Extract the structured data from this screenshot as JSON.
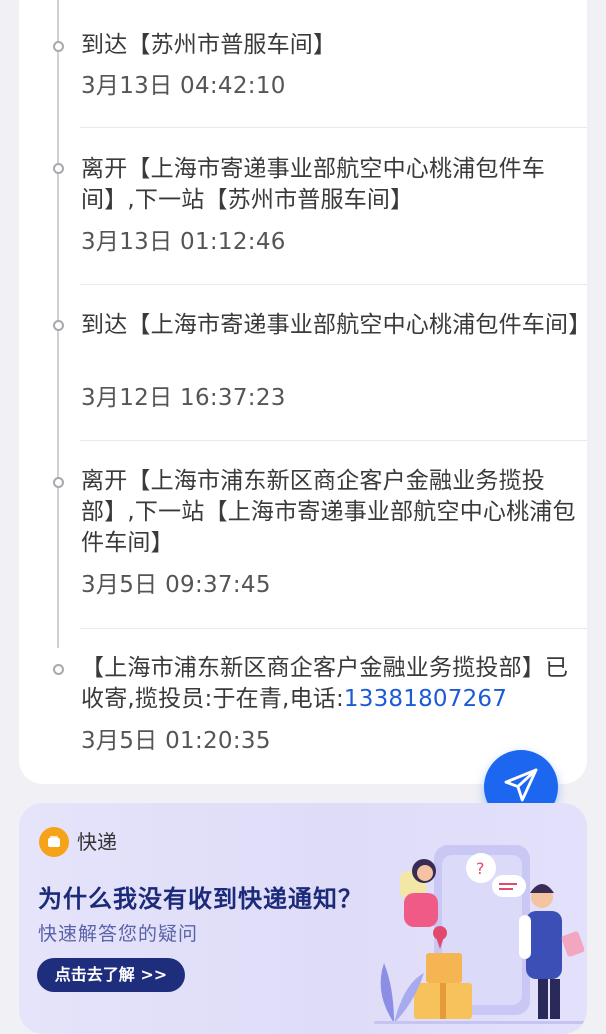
{
  "timeline": [
    {
      "text": "到达【苏州市普服车间】",
      "time": "3月13日 04:42:10"
    },
    {
      "text": "离开【上海市寄递事业部航空中心桃浦包件车间】,下一站【苏州市普服车间】",
      "time": "3月13日 01:12:46"
    },
    {
      "text": "到达【上海市寄递事业部航空中心桃浦包件车间】",
      "time": "3月12日 16:37:23"
    },
    {
      "text": "离开【上海市浦东新区商企客户金融业务揽投部】,下一站【上海市寄递事业部航空中心桃浦包件车间】",
      "time": "3月5日 09:37:45"
    },
    {
      "text_prefix": "【上海市浦东新区商企客户金融业务揽投部】已收寄,揽投员:于在青,电话:",
      "phone": "13381807267",
      "time": "3月5日 01:20:35"
    }
  ],
  "fab": {
    "icon": "send-icon",
    "color": "#1c66f0"
  },
  "promo": {
    "tag": "快递",
    "title": "为什么我没有收到快递通知？",
    "subtitle": "快速解答您的疑问",
    "button": "点击去了解 >>"
  }
}
